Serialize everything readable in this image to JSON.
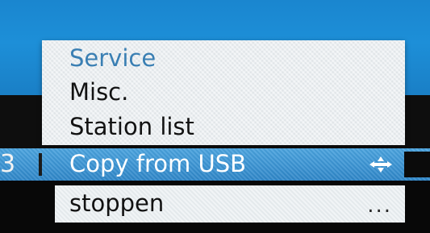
{
  "menu": {
    "header": "Service",
    "items": [
      {
        "label": "Misc."
      },
      {
        "label": "Station list"
      }
    ],
    "selected": {
      "left_indicator": "3",
      "label": "Copy from USB",
      "icon": "four-way-arrows-icon"
    },
    "bottom": {
      "label": "stoppen",
      "more": "..."
    }
  },
  "colors": {
    "accent_blue": "#1d8fd8",
    "selected_row": "#3c95d4",
    "panel": "#e9eef1",
    "header_text": "#3a7fb3"
  }
}
